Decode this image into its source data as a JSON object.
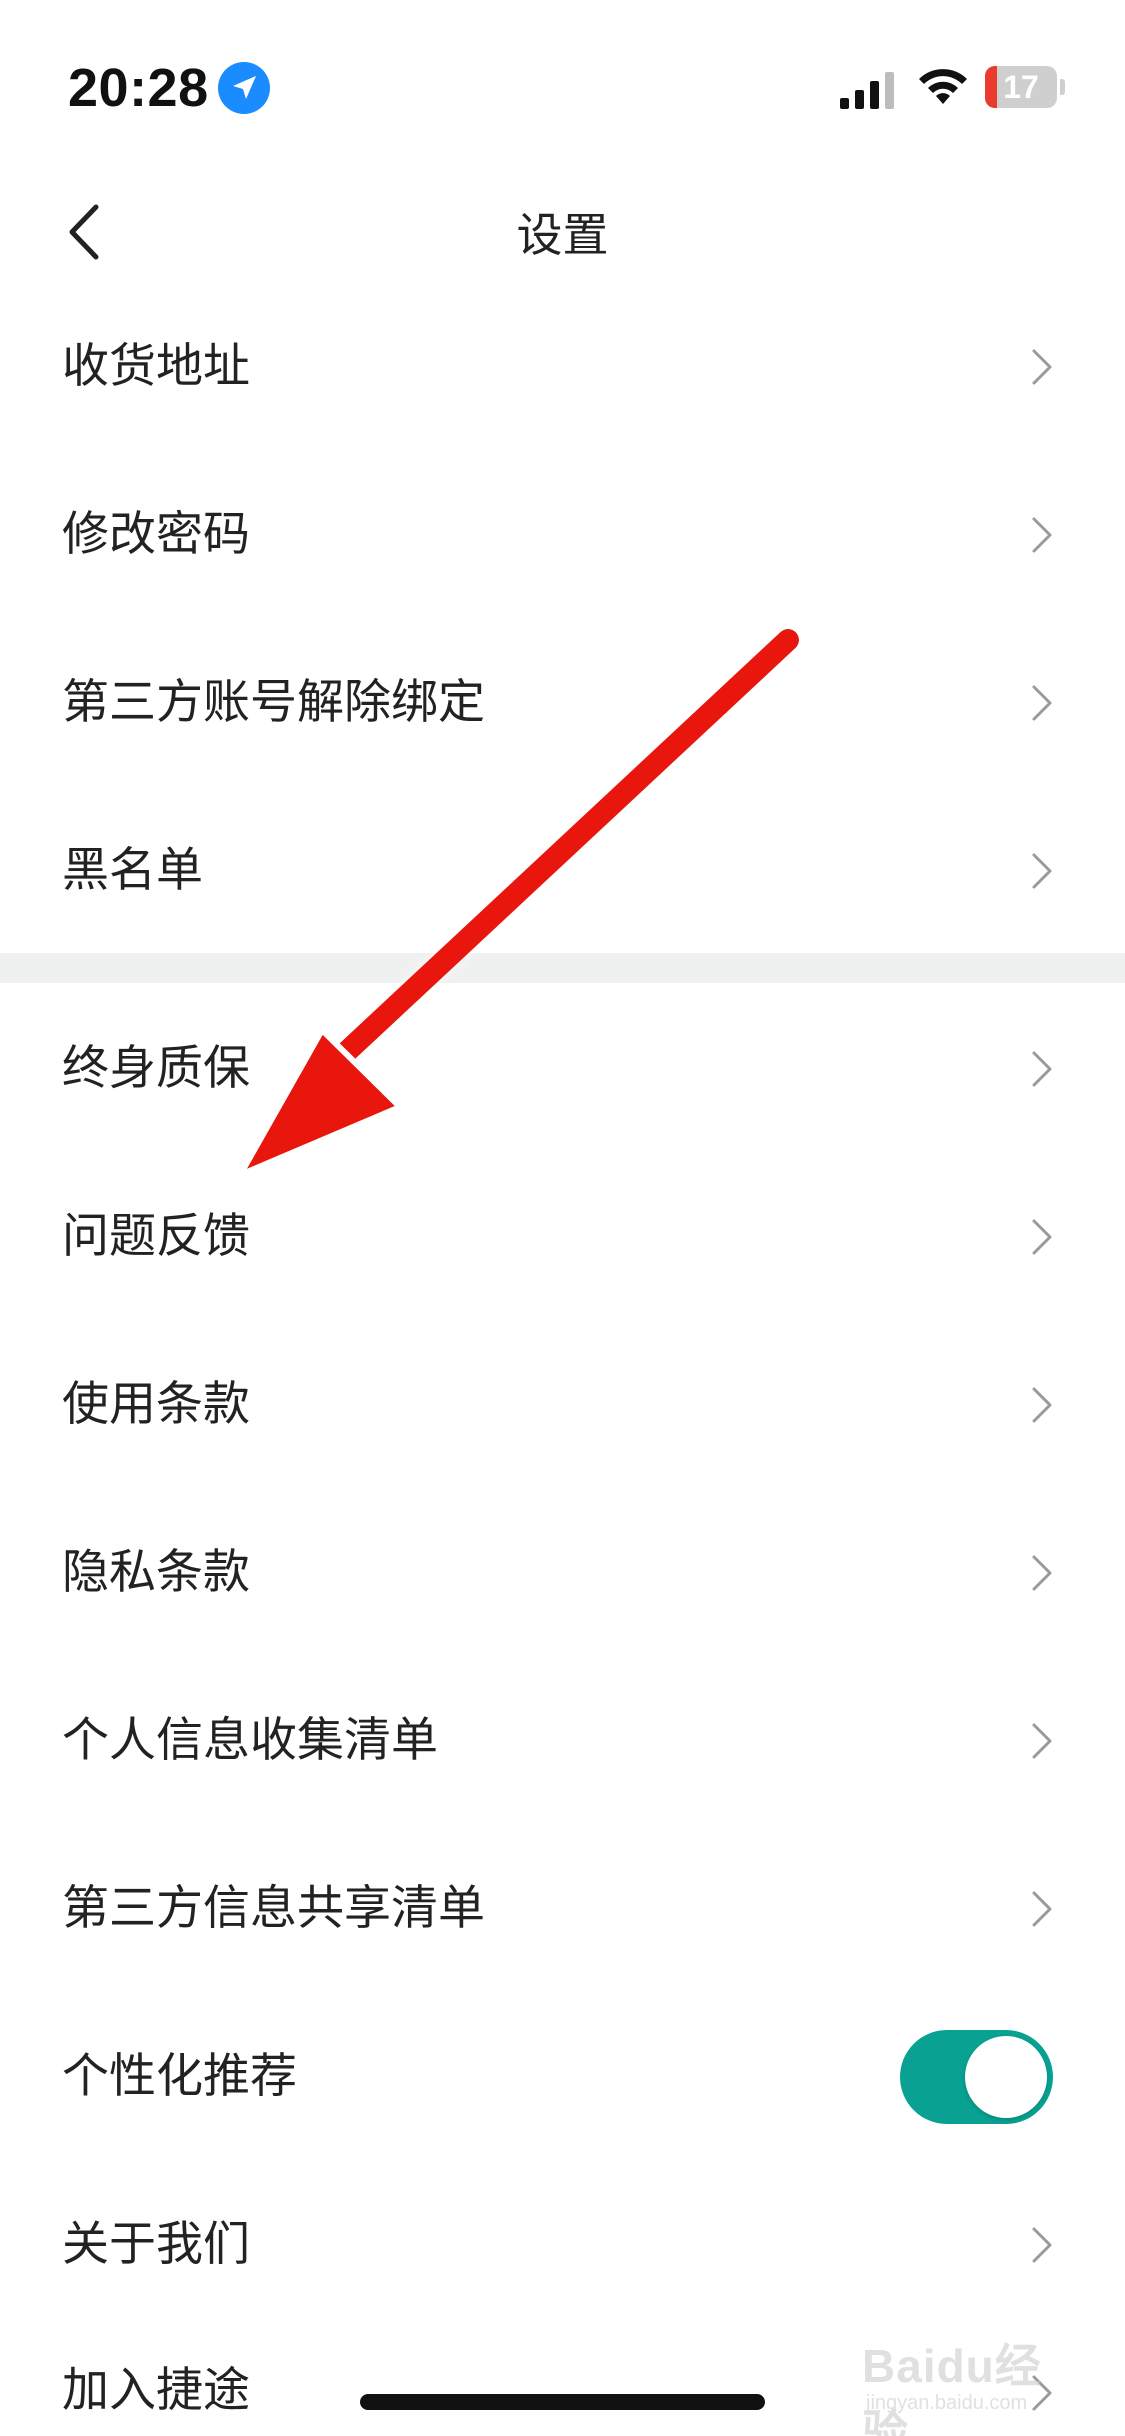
{
  "status_bar": {
    "time": "20:28",
    "battery_level": "17",
    "battery_fraction": 0.17,
    "location_icon": "location-arrow-icon",
    "signal_icon": "cellular-signal-icon",
    "wifi_icon": "wifi-icon"
  },
  "nav": {
    "title": "设置",
    "back_icon": "chevron-left-icon"
  },
  "settings": {
    "group1": [
      {
        "label": "收货地址"
      },
      {
        "label": "修改密码"
      },
      {
        "label": "第三方账号解除绑定"
      },
      {
        "label": "黑名单"
      }
    ],
    "group2": [
      {
        "label": "终身质保"
      },
      {
        "label": "问题反馈"
      },
      {
        "label": "使用条款"
      },
      {
        "label": "隐私条款"
      },
      {
        "label": "个人信息收集清单"
      },
      {
        "label": "第三方信息共享清单"
      },
      {
        "label": "个性化推荐",
        "toggle": true,
        "toggle_on": true
      },
      {
        "label": "关于我们"
      },
      {
        "label": "加入捷途"
      }
    ]
  },
  "colors": {
    "accent": "#08a192",
    "battery_low": "#ea3b2f",
    "divider": "#eef1ef",
    "annotation_arrow": "#e8120f"
  },
  "watermark": {
    "logo": "Baidu经验",
    "sub": "jingyan.baidu.com"
  }
}
